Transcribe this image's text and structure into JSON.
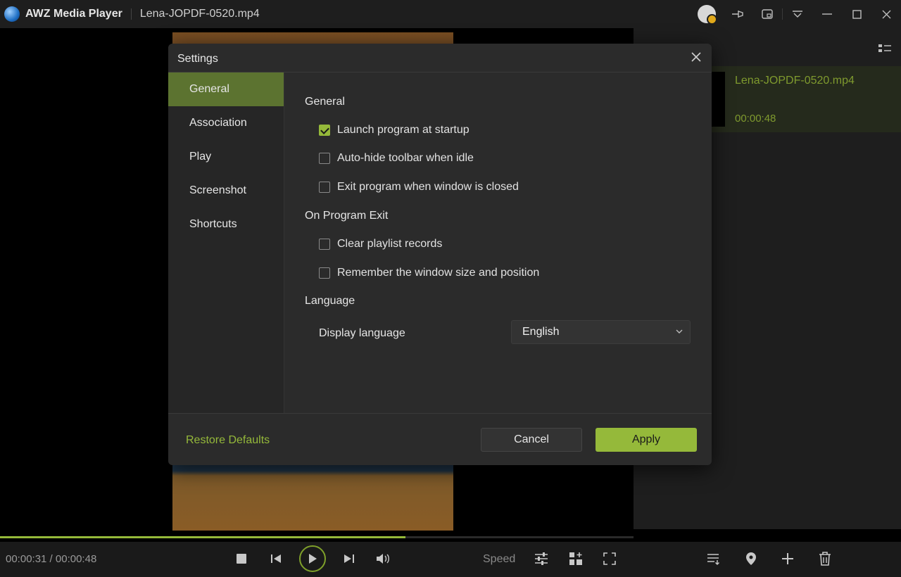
{
  "app": {
    "name": "AWZ Media Player",
    "file_title": "Lena-JOPDF-0520.mp4"
  },
  "titlebar_icons": [
    "avatar-icon",
    "pin-icon",
    "mini-mode-icon",
    "menu-dropdown-icon",
    "minimize-icon",
    "maximize-icon",
    "close-icon"
  ],
  "playlist": {
    "items": [
      {
        "name": "Lena-JOPDF-0520.mp4",
        "duration": "00:00:48"
      }
    ]
  },
  "player": {
    "time_display": "00:00:31 / 00:00:48",
    "progress": 0.64,
    "speed_label": "Speed",
    "accent_color": "#95b93a"
  },
  "settings": {
    "title": "Settings",
    "nav": [
      "General",
      "Association",
      "Play",
      "Screenshot",
      "Shortcuts"
    ],
    "active_nav": "General",
    "sections": {
      "general_title": "General",
      "general_options": [
        {
          "label": "Launch program at startup",
          "checked": true
        },
        {
          "label": "Auto-hide toolbar when idle",
          "checked": false
        },
        {
          "label": "Exit program when window is closed",
          "checked": false
        }
      ],
      "exit_title": "On Program Exit",
      "exit_options": [
        {
          "label": "Clear playlist records",
          "checked": false
        },
        {
          "label": "Remember the window size and position",
          "checked": false
        }
      ],
      "language_title": "Language",
      "display_language_label": "Display language",
      "display_language_value": "English"
    },
    "footer": {
      "restore": "Restore Defaults",
      "cancel": "Cancel",
      "apply": "Apply"
    }
  }
}
